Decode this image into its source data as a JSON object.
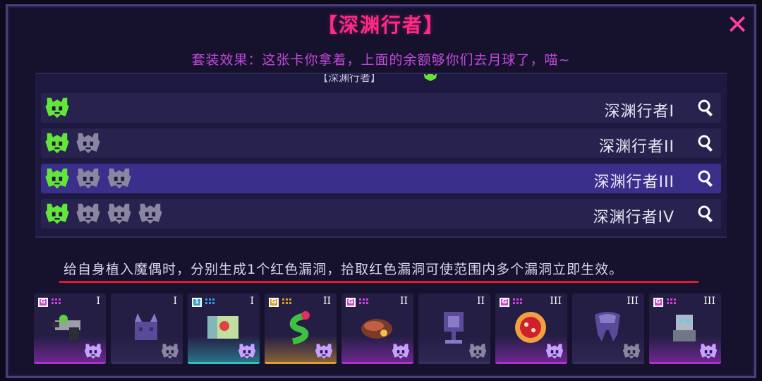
{
  "title": "【深渊行者】",
  "close_label": "✕",
  "subtitle": "套装效果：这张卡你拿着，上面的余额够你们去月球了，喵~",
  "list_header": "【深渊行者】",
  "rows": [
    {
      "name": "深渊行者I",
      "active_icons": 1,
      "inactive_icons": 0
    },
    {
      "name": "深渊行者II",
      "active_icons": 1,
      "inactive_icons": 1
    },
    {
      "name": "深渊行者III",
      "active_icons": 1,
      "inactive_icons": 2
    },
    {
      "name": "深渊行者IV",
      "active_icons": 1,
      "inactive_icons": 3
    }
  ],
  "selected_row": 2,
  "description": "给自身植入魔偶时，分别生成1个红色漏洞，拾取红色漏洞可使范围内多个漏洞立即生效。",
  "colors": {
    "title": "#ff2a86",
    "subtitle": "#c04ad8",
    "active_icon": "#63e63a",
    "inactive_icon": "#8a86a0",
    "underline": "#e01c2c"
  },
  "items": [
    {
      "badge": "G",
      "badge_color": "#d040e0",
      "tier": "I",
      "glow": "#b030d0",
      "art": "gun-icon",
      "art_colors": [
        "#2d2d3a",
        "#9e9ea8",
        "#60d040"
      ]
    },
    {
      "badge": "",
      "badge_color": "",
      "tier": "I",
      "glow": "#3a3060",
      "art": "cat-icon",
      "art_colors": [
        "#5a4a9a",
        "#8a7ac8",
        "#3b2f6a"
      ]
    },
    {
      "badge": "1",
      "badge_color": "#2aa0e0",
      "tier": "I",
      "glow": "#30c0c0",
      "art": "map-icon",
      "art_colors": [
        "#c0e0a0",
        "#4a8ad0",
        "#e04040"
      ]
    },
    {
      "badge": "G",
      "badge_color": "#e09a20",
      "tier": "II",
      "glow": "#e0a030",
      "art": "snake-icon",
      "art_colors": [
        "#40c040",
        "#e03060",
        "#1e1a30"
      ]
    },
    {
      "badge": "G",
      "badge_color": "#d040e0",
      "tier": "II",
      "glow": "#b030d0",
      "art": "bean-icon",
      "art_colors": [
        "#7a3a2a",
        "#c06040",
        "#f0c050"
      ]
    },
    {
      "badge": "",
      "badge_color": "",
      "tier": "II",
      "glow": "#3a3060",
      "art": "trophy-icon",
      "art_colors": [
        "#5a4a9a",
        "#8a7ac8",
        "#2a2050"
      ]
    },
    {
      "badge": "G",
      "badge_color": "#d040e0",
      "tier": "III",
      "glow": "#b030d0",
      "art": "pie-icon",
      "art_colors": [
        "#f0a040",
        "#d02030",
        "#fff0c0"
      ]
    },
    {
      "badge": "",
      "badge_color": "",
      "tier": "III",
      "glow": "#3a3060",
      "art": "tooth-icon",
      "art_colors": [
        "#5a4a9a",
        "#8a7ac8",
        "#2a2050"
      ]
    },
    {
      "badge": "G",
      "badge_color": "#d040e0",
      "tier": "III",
      "glow": "#b030d0",
      "art": "robot-icon",
      "art_colors": [
        "#b0b8c8",
        "#707888",
        "#60d0e0"
      ]
    }
  ]
}
